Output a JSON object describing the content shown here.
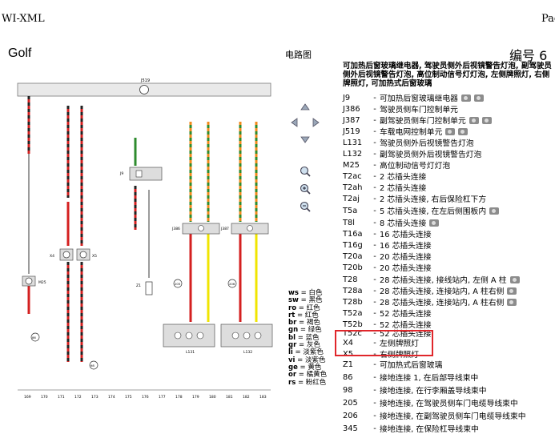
{
  "topbar": {
    "title": "WI-XML",
    "page_label": "Pag"
  },
  "header": {
    "brand": "Golf",
    "diagram_title": "电路图",
    "doc_number": "编号 6"
  },
  "caption": "可加热后窗玻璃继电器, 驾驶员侧外后视镜警告灯泡, 副驾驶员侧外后视镜警告灯泡, 高位制动信号灯灯泡, 左侧牌照灯, 右侧牌照灯, 可加热式后窗玻璃",
  "legend": [
    {
      "code": "J9",
      "desc": "可加热后窗玻璃继电器",
      "cameras": 2
    },
    {
      "code": "J386",
      "desc": "驾驶员侧车门控制单元",
      "cameras": 0
    },
    {
      "code": "J387",
      "desc": "副驾驶员侧车门控制单元",
      "cameras": 2
    },
    {
      "code": "J519",
      "desc": "车载电网控制单元",
      "cameras": 2
    },
    {
      "code": "L131",
      "desc": "驾驶员侧外后视镜警告灯泡",
      "cameras": 0
    },
    {
      "code": "L132",
      "desc": "副驾驶员侧外后视镜警告灯泡",
      "cameras": 0
    },
    {
      "code": "M25",
      "desc": "高位制动信号灯灯泡",
      "cameras": 0
    },
    {
      "code": "T2ac",
      "desc": "2 芯插头连接",
      "cameras": 0
    },
    {
      "code": "T2ah",
      "desc": "2 芯插头连接",
      "cameras": 0
    },
    {
      "code": "T2aj",
      "desc": "2 芯插头连接, 右后保险杠下方",
      "cameras": 0
    },
    {
      "code": "T5a",
      "desc": "5 芯插头连接, 在左后侧围板内",
      "cameras": 1
    },
    {
      "code": "T8l",
      "desc": "8 芯插头连接",
      "cameras": 1
    },
    {
      "code": "T16a",
      "desc": "16 芯插头连接",
      "cameras": 0
    },
    {
      "code": "T16g",
      "desc": "16 芯插头连接",
      "cameras": 0
    },
    {
      "code": "T20a",
      "desc": "20 芯插头连接",
      "cameras": 0
    },
    {
      "code": "T20b",
      "desc": "20 芯插头连接",
      "cameras": 0
    },
    {
      "code": "T28",
      "desc": "28 芯插头连接, 接线站内, 左侧 A 柱",
      "cameras": 1
    },
    {
      "code": "T28a",
      "desc": "28 芯插头连接, 连接站内, A 柱右侧",
      "cameras": 1
    },
    {
      "code": "T28b",
      "desc": "28 芯插头连接, 连接站内, A 柱右侧",
      "cameras": 1
    },
    {
      "code": "T52a",
      "desc": "52 芯插头连接",
      "cameras": 0
    },
    {
      "code": "T52b",
      "desc": "52 芯插头连接",
      "cameras": 0
    },
    {
      "code": "T52c",
      "desc": "52 芯插头连接",
      "cameras": 0
    },
    {
      "code": "X4",
      "desc": "左侧牌照灯",
      "cameras": 0
    },
    {
      "code": "X5",
      "desc": "右侧牌照灯",
      "cameras": 0
    },
    {
      "code": "Z1",
      "desc": "可加热式后窗玻璃",
      "cameras": 0
    },
    {
      "code": "86",
      "desc": "接地连接 1, 在后部导线束中",
      "cameras": 0
    },
    {
      "code": "98",
      "desc": "接地连接, 在行李厢盖导线束中",
      "cameras": 0
    },
    {
      "code": "205",
      "desc": "接地连接, 在驾驶员侧车门电缆导线束中",
      "cameras": 0
    },
    {
      "code": "206",
      "desc": "接地连接, 在副驾驶员侧车门电缆导线束中",
      "cameras": 0
    },
    {
      "code": "345",
      "desc": "接地连接, 在保险杠导线束中",
      "cameras": 0
    }
  ],
  "wire_colors": [
    {
      "abbr": "ws",
      "name": "白色"
    },
    {
      "abbr": "sw",
      "name": "黑色"
    },
    {
      "abbr": "ro",
      "name": "红色"
    },
    {
      "abbr": "rt",
      "name": "红色"
    },
    {
      "abbr": "br",
      "name": "褐色"
    },
    {
      "abbr": "gn",
      "name": "绿色"
    },
    {
      "abbr": "bl",
      "name": "蓝色"
    },
    {
      "abbr": "gr",
      "name": "灰色"
    },
    {
      "abbr": "li",
      "name": "淡紫色"
    },
    {
      "abbr": "vi",
      "name": "淡紫色"
    },
    {
      "abbr": "ge",
      "name": "黄色"
    },
    {
      "abbr": "or",
      "name": "橘黄色"
    },
    {
      "abbr": "rs",
      "name": "粉红色"
    }
  ],
  "schematic": {
    "bus_label": "J519",
    "column_numbers": [
      "169",
      "170",
      "171",
      "172",
      "173",
      "174",
      "175",
      "176",
      "177",
      "178",
      "179",
      "180",
      "181",
      "182",
      "183"
    ],
    "components": {
      "m25": "M25",
      "x4": "X4",
      "x5": "X5",
      "j9": "J9",
      "z1": "Z1",
      "l131": "L131",
      "l132": "L132",
      "j386": "J386",
      "j387": "J387"
    },
    "ground_labels": [
      "86",
      "98",
      "205",
      "206"
    ]
  },
  "colors": {
    "wire_red": "#d42020",
    "wire_green": "#2e8b2e",
    "wire_yellow": "#f0e500",
    "wire_orange": "#f28a1c",
    "highlight": "#e0262b"
  }
}
